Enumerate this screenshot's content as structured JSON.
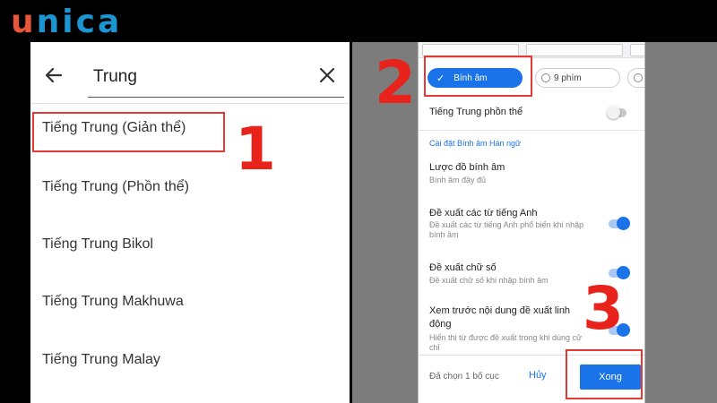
{
  "logo": {
    "first": "u",
    "rest": "nica"
  },
  "search": {
    "query": "Trung"
  },
  "languages": [
    "Tiếng Trung (Giản thể)",
    "Tiếng Trung (Phồn thể)",
    "Tiếng Trung Bikol",
    "Tiếng Trung Makhuwa",
    "Tiếng Trung Malay"
  ],
  "markers": {
    "one": "1",
    "two": "2",
    "three": "3"
  },
  "layouts": {
    "selected": "Bính âm",
    "other": "9 phím"
  },
  "settings": {
    "traditional_label": "Tiếng Trung phồn thể",
    "traditional_on": false,
    "section_title": "Cài đặt Bính âm Hán ngữ",
    "scheme_label": "Lược đồ bính âm",
    "scheme_value": "Bính âm đầy đủ",
    "english_label": "Đề xuất các từ tiếng Anh",
    "english_desc_1": "Đề xuất các từ tiếng Anh phổ biến khi nhập",
    "english_desc_2": "bính âm",
    "english_on": true,
    "digits_label": "Đề xuất chữ số",
    "digits_desc": "Đề xuất chữ số khi nhập bính âm",
    "digits_on": true,
    "preview_label_1": "Xem trước nội dung đề xuất linh",
    "preview_label_2": "động",
    "preview_desc_1": "Hiển thị từ được đề xuất trong khi dùng cử",
    "preview_desc_2": "chỉ",
    "preview_on": true
  },
  "footer": {
    "selected_count": "Đã chọn 1 bố cục",
    "cancel": "Hủy",
    "done": "Xong"
  },
  "colors": {
    "accent": "#1a73e8",
    "highlight": "#e53935",
    "logo_orange": "#e8563a",
    "logo_blue": "#1c96d3"
  }
}
